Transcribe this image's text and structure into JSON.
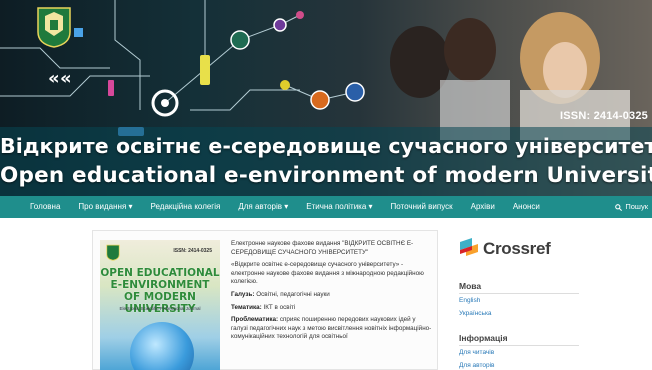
{
  "banner": {
    "issn": "ISSN: 2414-0325",
    "title_ua": "Відкрите освітнє е-середовище сучасного університету",
    "title_en": "Open educational e-environment of modern University"
  },
  "nav": {
    "items": [
      "Головна",
      "Про видання ▾",
      "Редакційна колегія",
      "Для авторів ▾",
      "Етична політика ▾",
      "Поточний випуск",
      "Архіви",
      "Анонси"
    ],
    "search_label": "Пошук"
  },
  "cover": {
    "issn": "ISSN: 2414-0325",
    "title_lines": [
      "OPEN EDUCATIONAL",
      "E-ENVIRONMENT",
      "OF MODERN UNIVERSITY"
    ],
    "subtitle": "Electronic Scientific Professional Journal"
  },
  "description": {
    "journal_name": "Електронне наукове фахове видання \"ВІДКРИТЕ ОСВІТНЄ Е-СЕРЕДОВИЩЕ СУЧАСНОГО УНІВЕРСИТЕТУ\"",
    "intro": "«Відкрите освітнє е-середовище сучасного університету» - електронне наукове фахове видання з міжнародною редакційною колегією.",
    "branches_label": "Галузь:",
    "branches_value": "Освітні, педагогічні науки",
    "topic_label": "Тематика:",
    "topic_value": "ІКТ в освіті",
    "problem_label": "Проблематика:",
    "problem_value": "сприяє поширенню передових наукових ідей у галузі педагогічних наук з метою висвітлення новітніх інформаційно-комунікаційних технологій для освітньої"
  },
  "sidebar": {
    "crossref": "Crossref",
    "language_heading": "Мова",
    "languages": [
      "English",
      "Українська"
    ],
    "info_heading": "Інформація",
    "info_links": [
      "Для читачів",
      "Для авторів"
    ]
  },
  "colors": {
    "nav_bg": "#1f8e8c",
    "link": "#2a7ab8",
    "cover_title": "#2e8b3a"
  }
}
